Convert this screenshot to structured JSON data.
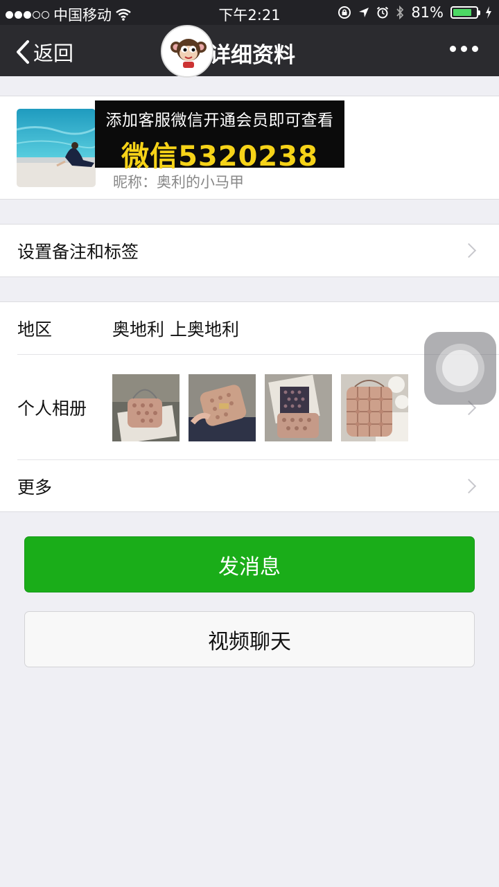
{
  "status_bar": {
    "carrier": "中国移动",
    "time": "下午2:21",
    "battery_percent": "81%",
    "battery_level": 0.81
  },
  "nav": {
    "back_label": "返回",
    "title": "详细资料"
  },
  "profile": {
    "promo_line1": "添加客服微信开通会员即可查看",
    "promo_line2": "微信5320238",
    "nickname": "昵称：奥利的小马甲"
  },
  "rows": {
    "remark_label": "设置备注和标签",
    "region_label": "地区",
    "region_value": "奥地利 上奥地利",
    "album_label": "个人相册",
    "more_label": "更多"
  },
  "buttons": {
    "send_message": "发消息",
    "video_call": "视频聊天"
  },
  "colors": {
    "primary_green": "#1aad19",
    "nav_bg": "#2b2b2f",
    "promo_yellow": "#f6d318"
  },
  "icons": [
    "wifi-icon",
    "lock-rotation-icon",
    "location-icon",
    "alarm-icon",
    "bluetooth-icon",
    "battery-icon",
    "charging-icon",
    "back-chevron-icon",
    "more-dots-icon",
    "chevron-right-icon",
    "assistive-touch-icon"
  ]
}
